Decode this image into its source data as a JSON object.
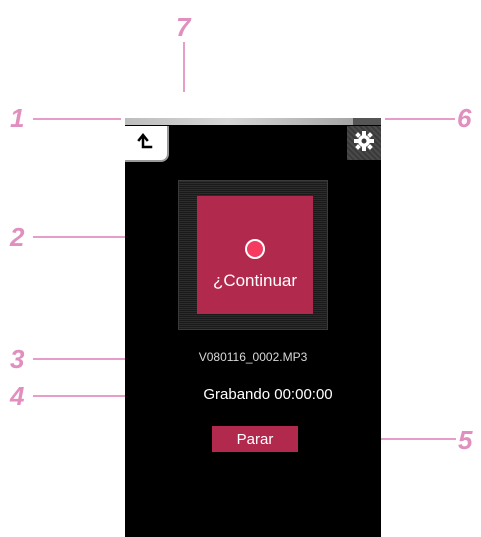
{
  "callouts": {
    "n1": "1",
    "n2": "2",
    "n3": "3",
    "n4": "4",
    "n5": "5",
    "n6": "6",
    "n7": "7"
  },
  "device": {
    "record_button_label": "¿Continuar",
    "filename": "V080116_0002.MP3",
    "status": "Grabando 00:00:00",
    "stop_label": "Parar"
  },
  "colors": {
    "accent": "#b12a4d",
    "record_dot": "#f53b5f",
    "callout": "#e08fbf"
  },
  "icons": {
    "back": "back-arrow-icon",
    "settings": "gear-icon",
    "record": "record-dot-icon"
  }
}
